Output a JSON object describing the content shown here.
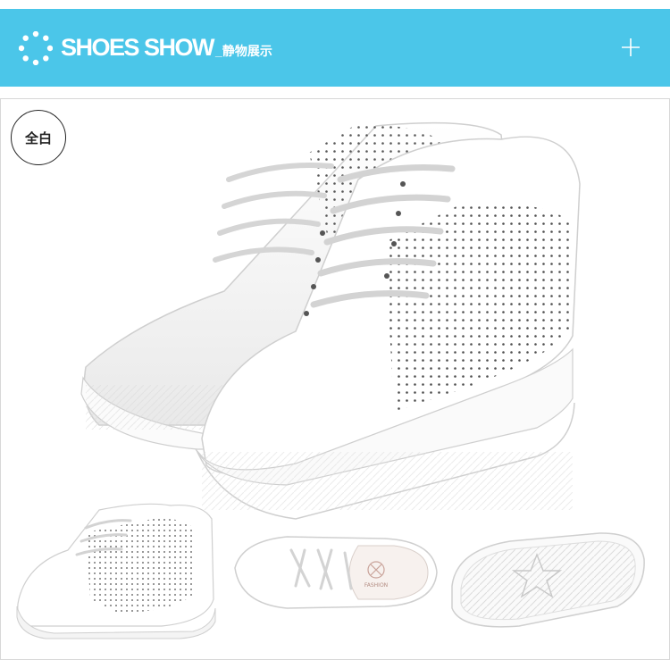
{
  "header": {
    "title": "SHOES SHOW",
    "subtitle": "_静物展示",
    "background_color": "#4bc6e9",
    "icons": [
      "dot-ring-icon",
      "plus-icon"
    ]
  },
  "badge": {
    "label": "全白"
  },
  "insole_print": {
    "brand": "FASHION"
  }
}
